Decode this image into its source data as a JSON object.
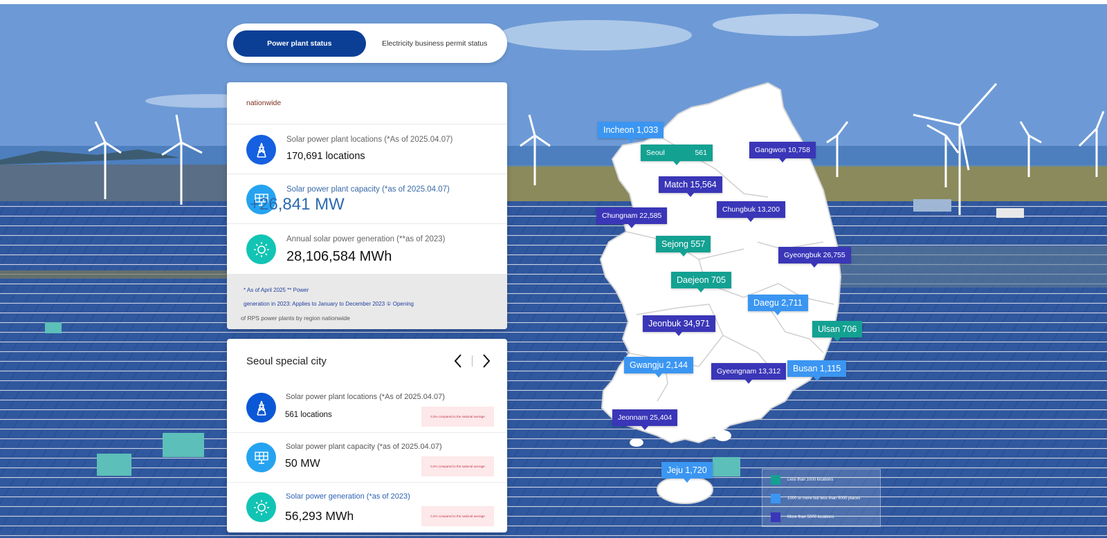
{
  "tabs": {
    "power_plant_status": "Power plant status",
    "electricity_permit_status": "Electricity business permit status"
  },
  "national": {
    "heading": "nationwide",
    "locations_label": "Solar power plant locations (*As of 2025.04.07)",
    "locations_value": "170,691 locations",
    "capacity_label": "Solar power plant capacity (*as of 2025.04.07)",
    "capacity_value": "+26,841 MW",
    "generation_label": "Annual solar power generation (**as of 2023)",
    "generation_value": "28,106,584 MWh",
    "note_line1": "* As of April 2025 ** Power",
    "note_line2": "generation in 2023: Applies to January to December 2023 ① Opening",
    "note_line3": "of RPS power plants by region nationwide"
  },
  "region": {
    "title": "Seoul special city",
    "prev_icon": "chevron-left-icon",
    "next_icon": "chevron-right-icon",
    "locations_label": "Solar power plant locations (*As of 2025.04.07)",
    "locations_value": "561 locations",
    "locations_compare": "0.3% compared to the national average",
    "capacity_label": "Solar power plant capacity (*as of 2025.04.07)",
    "capacity_value": "50 MW",
    "capacity_compare": "0.2% compared to the national average",
    "generation_label": "Solar power generation (*as of 2023)",
    "generation_value": "56,293 MWh",
    "generation_compare": "0.2% compared to the national average"
  },
  "map_labels": {
    "incheon": "Incheon 1,033",
    "seoul_name": "Seoul",
    "seoul_value": "561",
    "gangwon": "Gangwon 10,758",
    "match": "Match 15,564",
    "chungbuk": "Chungbuk 13,200",
    "chungnam": "Chungnam 22,585",
    "sejong": "Sejong 557",
    "gyeongbuk": "Gyeongbuk 26,755",
    "daejeon": "Daejeon 705",
    "daegu": "Daegu 2,711",
    "jeonbuk": "Jeonbuk 34,971",
    "ulsan": "Ulsan 706",
    "gwangju": "Gwangju 2,144",
    "gyeongnam": "Gyeongnam 13,312",
    "busan": "Busan 1,115",
    "jeonnam": "Jeonnam 25,404",
    "jeju": "Jeju 1,720"
  },
  "legend": {
    "tier1": "Less than 1000 locations",
    "tier2": "1000 or more but less than 5000 places",
    "tier3": "More than 5000 locations"
  },
  "colors": {
    "tier_low": "#13a192",
    "tier_mid": "#3b96f2",
    "tier_high": "#3a36b8",
    "active_tab": "#0b3f96"
  }
}
